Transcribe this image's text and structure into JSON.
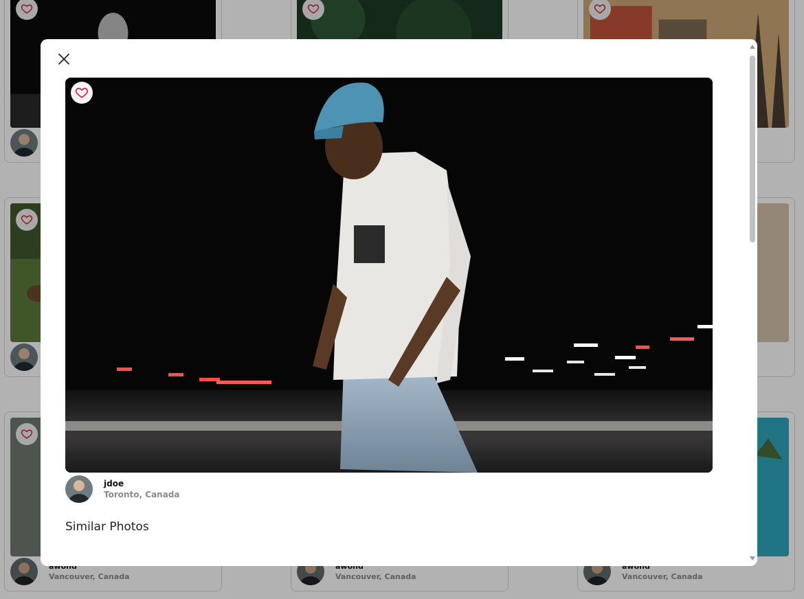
{
  "gallery": {
    "cards": [
      {
        "name": "",
        "location": ""
      },
      {
        "name": "",
        "location": ""
      },
      {
        "name": "",
        "location": ""
      },
      {
        "name": "",
        "location": ""
      },
      {
        "name": "",
        "location": ""
      },
      {
        "name": "awond",
        "location": "Vancouver, Canada"
      },
      {
        "name": "awond",
        "location": "Vancouver, Canada"
      },
      {
        "name": "awond",
        "location": "Vancouver, Canada"
      }
    ]
  },
  "modal": {
    "close_icon": "close-icon",
    "favorite_icon": "heart-outline-icon",
    "author": {
      "name": "jdoe",
      "location": "Toronto, Canada"
    },
    "section_title": "Similar Photos"
  },
  "colors": {
    "heart": "#d61f3a",
    "overlay": "rgba(0,0,0,0.30)"
  }
}
